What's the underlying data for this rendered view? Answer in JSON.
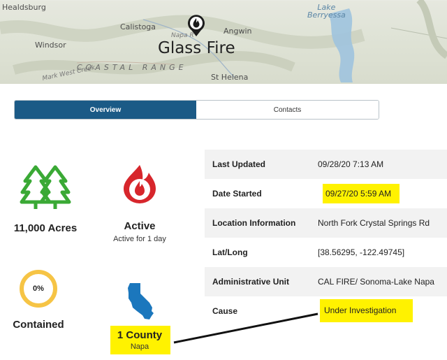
{
  "map": {
    "places": {
      "healdsburg": "Healdsburg",
      "calistoga": "Calistoga",
      "napa_road": "Napa R",
      "angwin": "Angwin",
      "windsor": "Windsor",
      "coastal_range": "COASTAL RANGE",
      "st_helena": "St Helena",
      "west_creek": "Mark West Creek",
      "lake_line1": "Lake",
      "lake_line2": "Berryessa"
    },
    "fire_title": "Glass Fire"
  },
  "tabs": [
    {
      "label": "Overview",
      "active": true
    },
    {
      "label": "Contacts",
      "active": false
    }
  ],
  "stats": {
    "acres": {
      "label": "11,000 Acres",
      "icon": "trees-icon",
      "color": "#3aa935"
    },
    "status": {
      "label": "Active",
      "sub": "Active for 1 day",
      "icon": "fire-icon",
      "color": "#d7262c"
    },
    "containment": {
      "percent": "0%",
      "label": "Contained",
      "fraction": 0,
      "ring_color": "#f6c445"
    },
    "counties": {
      "label": "1 County",
      "sub": "Napa",
      "icon": "california-icon",
      "color": "#1b77bd"
    }
  },
  "info": [
    {
      "key": "Last Updated",
      "value": "09/28/20 7:13 AM"
    },
    {
      "key": "Date Started",
      "value": "09/27/20 5:59 AM"
    },
    {
      "key": "Location Information",
      "value": "North Fork Crystal Springs Rd"
    },
    {
      "key": "Lat/Long",
      "value": "[38.56295, -122.49745]"
    },
    {
      "key": "Administrative Unit",
      "value": "CAL FIRE/ Sonoma-Lake Napa"
    },
    {
      "key": "Cause",
      "value": "Under Investigation"
    }
  ],
  "colors": {
    "highlight": "#fff200",
    "tab_active": "#1b5a86"
  }
}
